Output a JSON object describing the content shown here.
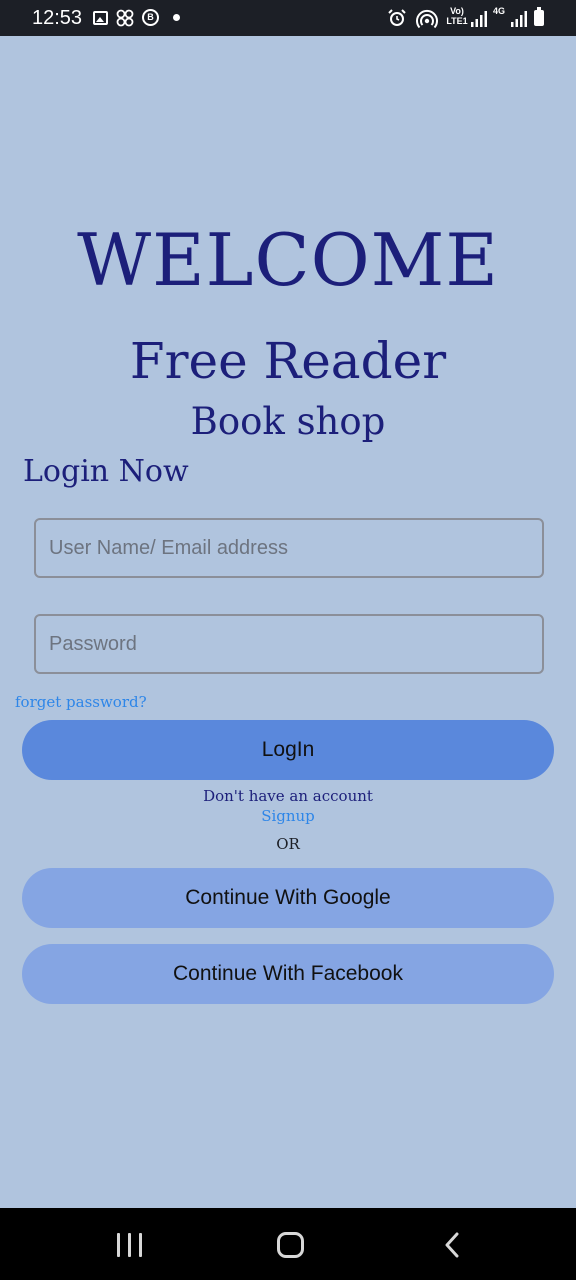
{
  "status_bar": {
    "time": "12:53",
    "bubble_letter": "B",
    "volte_label": "Vo)\nLTE1",
    "network_label": "4G",
    "icons": [
      "gallery-icon",
      "clover-icon",
      "b-bubble-icon",
      "dot-icon",
      "alarm-icon",
      "hotspot-icon",
      "volte-icon",
      "signal-icon",
      "4g-icon",
      "signal-icon",
      "battery-icon"
    ]
  },
  "header": {
    "welcome": "WELCOME",
    "app_name": "Free Reader",
    "app_sub": "Book shop"
  },
  "login": {
    "title": "Login Now",
    "username_placeholder": "User Name/ Email address",
    "password_placeholder": "Password",
    "forgot_link": "forget password?",
    "login_button": "LogIn",
    "no_account_text": "Don't have an account",
    "signup_link": "Signup",
    "or_text": "OR",
    "google_button": "Continue With Google",
    "facebook_button": "Continue With Facebook"
  },
  "colors": {
    "background": "#b0c4de",
    "heading": "#1c1f7a",
    "link": "#2e86e8",
    "login_button": "#5a88dc",
    "social_button": "#85a5e3"
  },
  "nav_bar": {
    "icons": [
      "recents-icon",
      "home-icon",
      "back-icon"
    ]
  }
}
